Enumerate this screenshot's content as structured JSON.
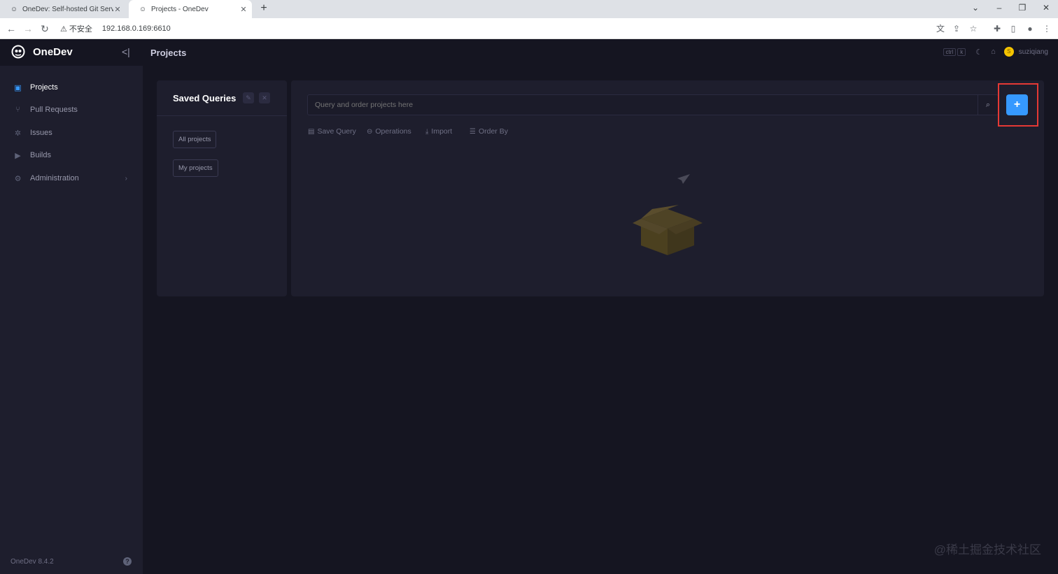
{
  "browser": {
    "tabs": [
      {
        "title": "OneDev: Self-hosted Git Server",
        "active": false
      },
      {
        "title": "Projects - OneDev",
        "active": true
      }
    ],
    "security_label": "不安全",
    "url": "192.168.0.169:6610"
  },
  "app": {
    "brand": "OneDev",
    "page_title": "Projects",
    "shortcut_keys": [
      "ctrl",
      "k"
    ],
    "user": "suziqiang",
    "user_initial": "S",
    "version": "OneDev 8.4.2"
  },
  "sidebar": {
    "items": [
      {
        "label": "Projects",
        "icon": "project-icon",
        "active": true
      },
      {
        "label": "Pull Requests",
        "icon": "pull-request-icon",
        "active": false
      },
      {
        "label": "Issues",
        "icon": "bug-icon",
        "active": false
      },
      {
        "label": "Builds",
        "icon": "play-icon",
        "active": false
      },
      {
        "label": "Administration",
        "icon": "gear-icon",
        "active": false
      }
    ]
  },
  "saved_queries": {
    "title": "Saved Queries",
    "queries": [
      "All projects",
      "My projects"
    ]
  },
  "main": {
    "search_placeholder": "Query and order projects here",
    "toolbar": {
      "save_query": "Save Query",
      "operations": "Operations",
      "import": "Import",
      "order_by": "Order By"
    },
    "add_label": "+"
  },
  "watermark": "@稀土掘金技术社区",
  "colors": {
    "accent": "#3699ff",
    "highlight": "#e53935",
    "sidebar_bg": "#1e1e2d",
    "page_bg": "#151521"
  }
}
